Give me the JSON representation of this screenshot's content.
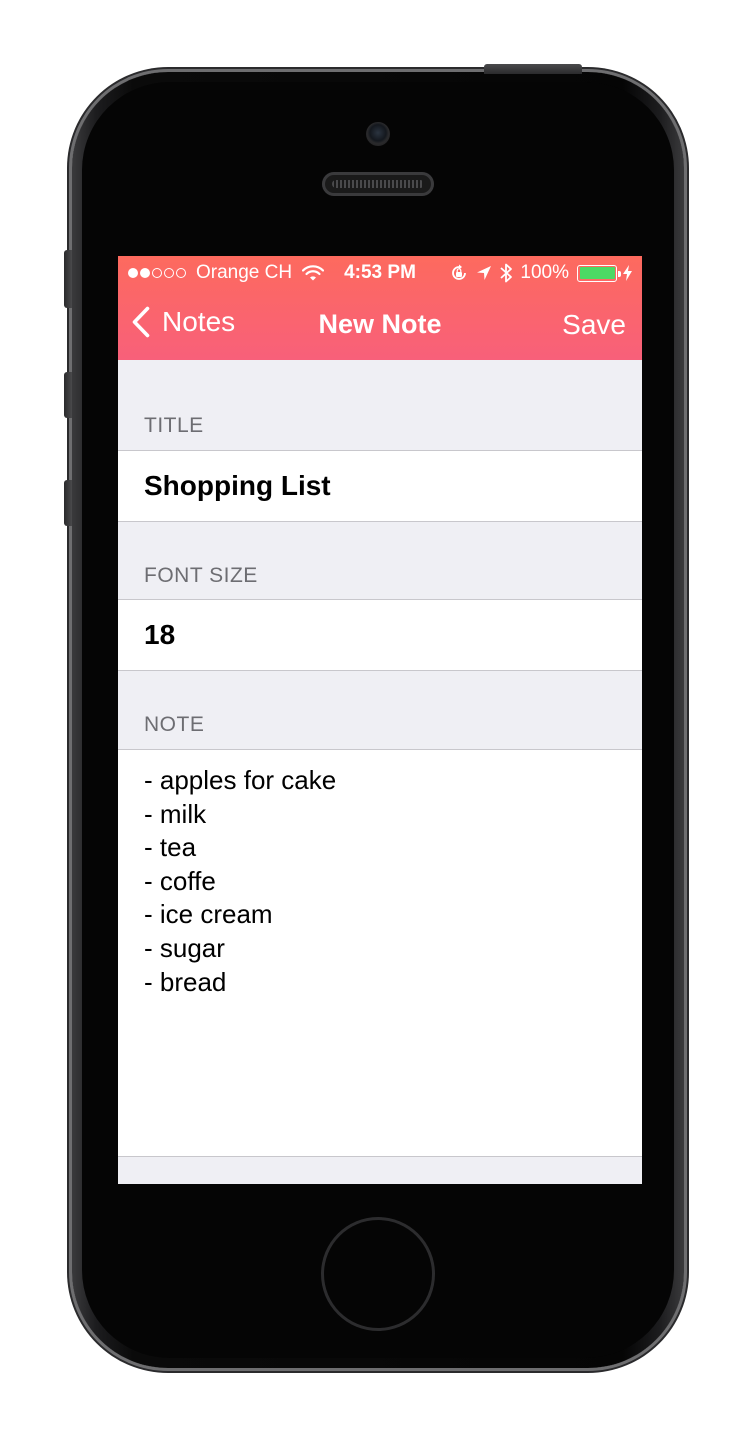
{
  "status_bar": {
    "carrier": "Orange CH",
    "time": "4:53 PM",
    "battery": "100%",
    "battery_level": 1.0,
    "signal_strength": 2,
    "signal_max": 5
  },
  "nav": {
    "back_label": "Notes",
    "title": "New Note",
    "save_label": "Save"
  },
  "form": {
    "title": {
      "header": "TITLE",
      "value": "Shopping List"
    },
    "font_size": {
      "header": "FONT SIZE",
      "value": "18"
    },
    "note": {
      "header": "NOTE",
      "lines": [
        "- apples for cake",
        "- milk",
        "- tea",
        "- coffe",
        "- ice cream",
        "- sugar",
        "- bread"
      ]
    }
  },
  "colors": {
    "nav_gradient_top": "#fd6a5e",
    "nav_gradient_bottom": "#f8607a",
    "background": "#efeff4",
    "battery_fill": "#4cd964"
  },
  "icons": [
    "chevron-left-icon",
    "wifi-icon",
    "rotation-lock-icon",
    "location-icon",
    "bluetooth-icon",
    "battery-icon",
    "charging-icon"
  ]
}
